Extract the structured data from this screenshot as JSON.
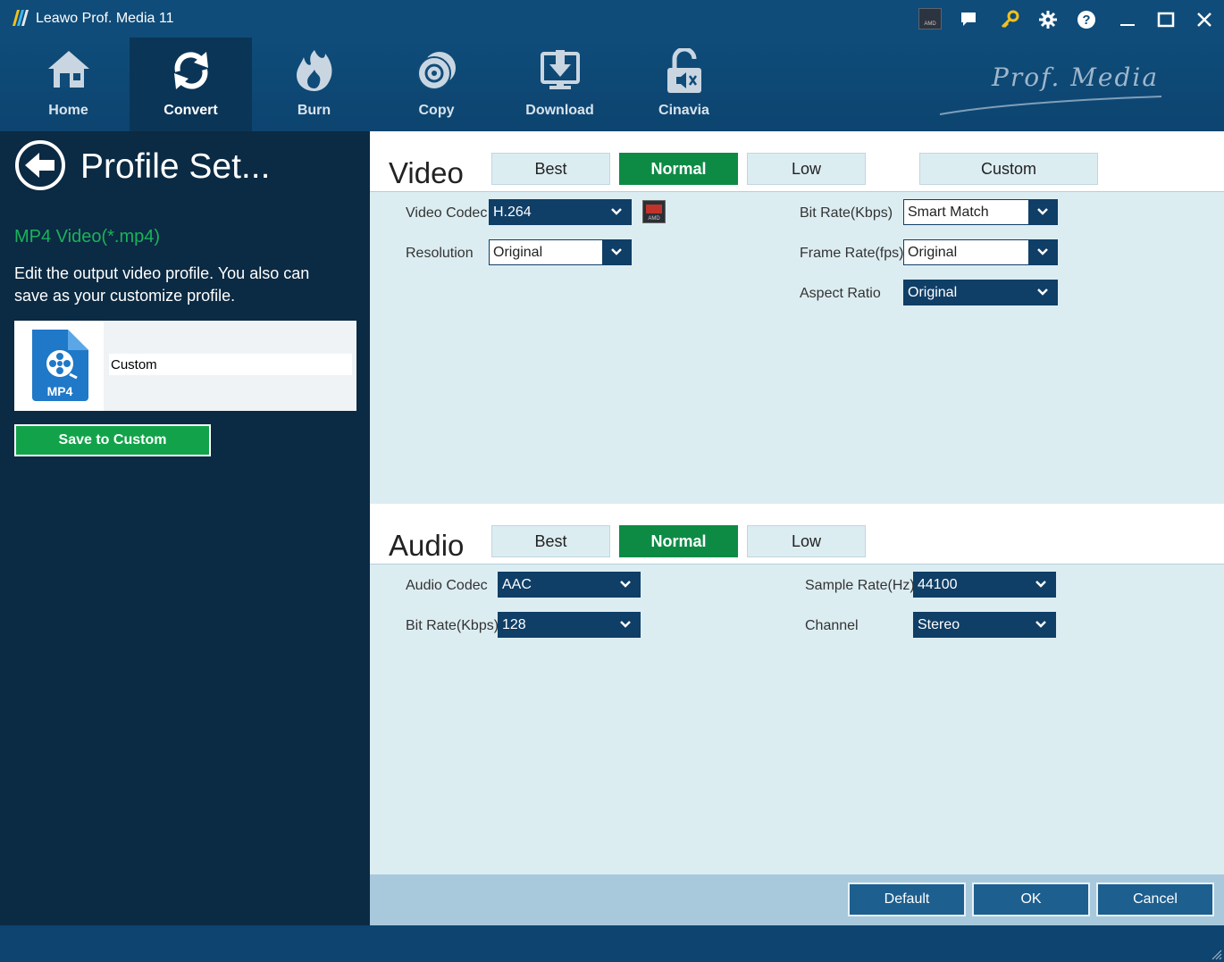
{
  "window": {
    "title": "Leawo Prof. Media 11",
    "brand": "Prof. Media",
    "amd_badge": "AMD"
  },
  "nav": {
    "items": [
      {
        "label": "Home",
        "icon": "home-icon"
      },
      {
        "label": "Convert",
        "icon": "convert-icon",
        "active": true
      },
      {
        "label": "Burn",
        "icon": "burn-icon"
      },
      {
        "label": "Copy",
        "icon": "copy-icon"
      },
      {
        "label": "Download",
        "icon": "download-icon"
      },
      {
        "label": "Cinavia",
        "icon": "cinavia-icon"
      }
    ]
  },
  "left": {
    "title": "Profile Set...",
    "format": "MP4 Video(*.mp4)",
    "description": "Edit the output video profile. You also can save as your customize profile.",
    "file_badge": "MP4",
    "profile_name": "Custom",
    "save_label": "Save to Custom"
  },
  "video": {
    "title": "Video",
    "presets": [
      "Best",
      "Normal",
      "Low",
      "Custom"
    ],
    "active_preset": "Normal",
    "codec_label": "Video Codec",
    "codec_value": "H.264",
    "resolution_label": "Resolution",
    "resolution_value": "Original",
    "bitrate_label": "Bit Rate(Kbps)",
    "bitrate_value": "Smart Match",
    "framerate_label": "Frame Rate(fps)",
    "framerate_value": "Original",
    "aspect_label": "Aspect Ratio",
    "aspect_value": "Original"
  },
  "audio": {
    "title": "Audio",
    "presets": [
      "Best",
      "Normal",
      "Low"
    ],
    "active_preset": "Normal",
    "codec_label": "Audio Codec",
    "codec_value": "AAC",
    "bitrate_label": "Bit Rate(Kbps)",
    "bitrate_value": "128",
    "samplerate_label": "Sample Rate(Hz)",
    "samplerate_value": "44100",
    "channel_label": "Channel",
    "channel_value": "Stereo"
  },
  "footer": {
    "default_label": "Default",
    "ok_label": "OK",
    "cancel_label": "Cancel"
  },
  "colors": {
    "titlebar": "#0f4c79",
    "left_panel": "#0b2a43",
    "accent_green": "#0d8b45",
    "format_green": "#19b35a",
    "select_blue": "#0f3e66"
  }
}
